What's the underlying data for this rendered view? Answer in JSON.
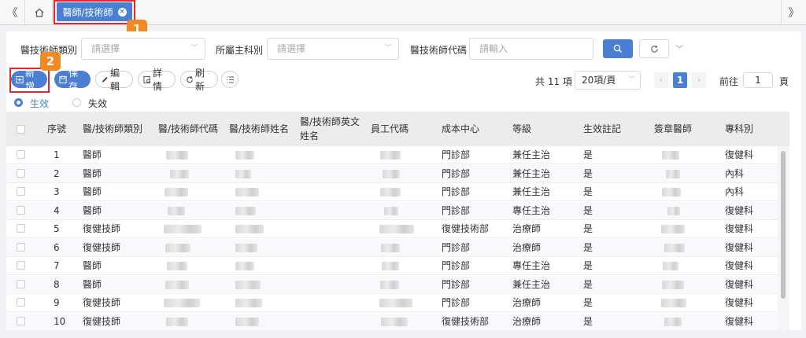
{
  "tabs": {
    "prev_icon": "《",
    "next_icon": "》",
    "active_label": "醫師/技術師",
    "close_icon": "×"
  },
  "annotations": {
    "badge1": "1",
    "badge2": "2"
  },
  "filters": {
    "type_label": "醫技術師類別",
    "type_placeholder": "請選擇",
    "dept_label": "所屬主科別",
    "dept_placeholder": "請選擇",
    "code_label": "醫技術師代碼",
    "code_placeholder": "請輸入"
  },
  "toolbar": {
    "add_label": "新增",
    "save_label": "保存",
    "edit_label": "編輯",
    "detail_label": "詳情",
    "refresh_label": "刷新"
  },
  "pager": {
    "total": "共 11 項",
    "page_size": "20項/頁",
    "current_page": "1",
    "goto_label": "前往",
    "goto_value": "1",
    "page_suffix": "頁"
  },
  "status_filter": {
    "active_label": "生效",
    "inactive_label": "失效"
  },
  "table": {
    "headers": [
      "序號",
      "醫/技術師類別",
      "醫/技術師代碼",
      "醫/技術師姓名",
      "醫/技術師英文姓名",
      "員工代碼",
      "成本中心",
      "等級",
      "生效註記",
      "簽章醫師",
      "專科別"
    ],
    "rows": [
      {
        "no": "1",
        "type": "醫師",
        "cost": "門診部",
        "level": "兼任主治",
        "eff": "是",
        "spec": "復健科"
      },
      {
        "no": "2",
        "type": "醫師",
        "cost": "門診部",
        "level": "兼任主治",
        "eff": "是",
        "spec": "內科"
      },
      {
        "no": "3",
        "type": "醫師",
        "cost": "門診部",
        "level": "兼任主治",
        "eff": "是",
        "spec": "內科"
      },
      {
        "no": "4",
        "type": "醫師",
        "cost": "門診部",
        "level": "專任主治",
        "eff": "是",
        "spec": "復健科"
      },
      {
        "no": "5",
        "type": "復健技師",
        "cost": "復健技術部",
        "level": "治療師",
        "eff": "是",
        "spec": "復健科"
      },
      {
        "no": "6",
        "type": "復健技師",
        "cost": "門診部",
        "level": "治療師",
        "eff": "是",
        "spec": "復健科"
      },
      {
        "no": "7",
        "type": "醫師",
        "cost": "門診部",
        "level": "專任主治",
        "eff": "是",
        "spec": "復健科"
      },
      {
        "no": "8",
        "type": "醫師",
        "cost": "門診部",
        "level": "兼任主治",
        "eff": "是",
        "spec": "復健科"
      },
      {
        "no": "9",
        "type": "復健技師",
        "cost": "門診部",
        "level": "治療師",
        "eff": "是",
        "spec": "復健科"
      },
      {
        "no": "10",
        "type": "復健技師",
        "cost": "復健技術部",
        "level": "治療師",
        "eff": "是",
        "spec": "復健科"
      }
    ]
  },
  "colors": {
    "primary": "#4a7fd4",
    "annotation_red": "#e0262e",
    "annotation_orange": "#f08a24"
  }
}
